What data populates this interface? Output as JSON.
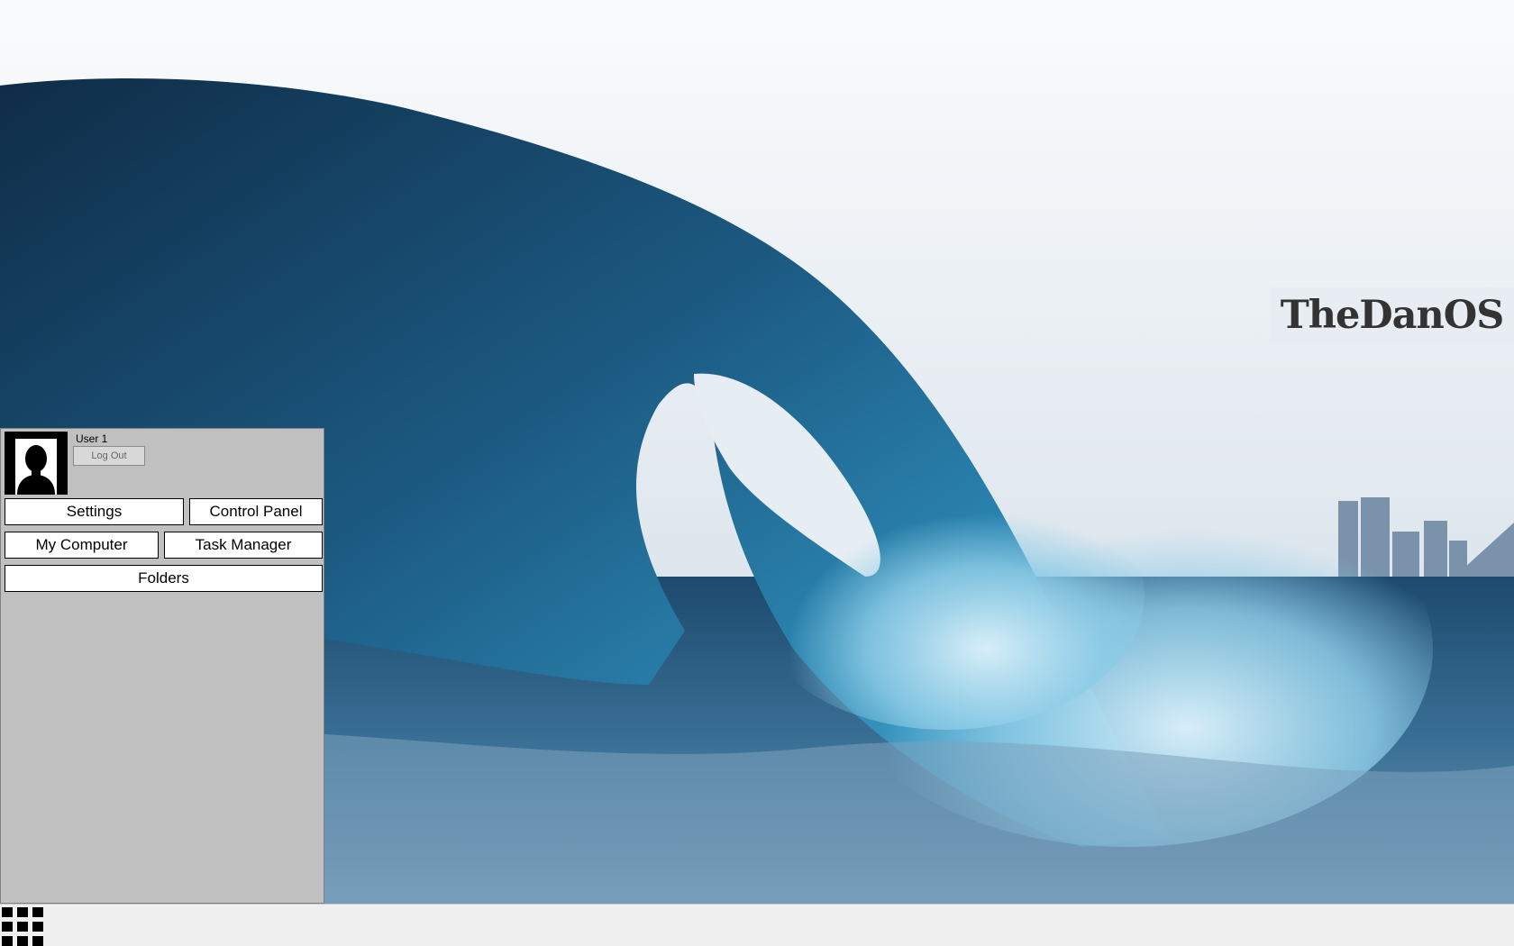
{
  "desktop": {
    "logo_text": "TheDanOS"
  },
  "start_menu": {
    "username": "User 1",
    "logout_label": "Log Out",
    "buttons": {
      "settings": "Settings",
      "control_panel": "Control Panel",
      "my_computer": "My Computer",
      "task_manager": "Task Manager",
      "folders": "Folders"
    }
  },
  "taskbar": {
    "start_icon": "grid-icon"
  },
  "colors": {
    "menu_background": "#c0c0c0",
    "taskbar_background": "#f0f0f0",
    "button_background": "#ffffff"
  }
}
